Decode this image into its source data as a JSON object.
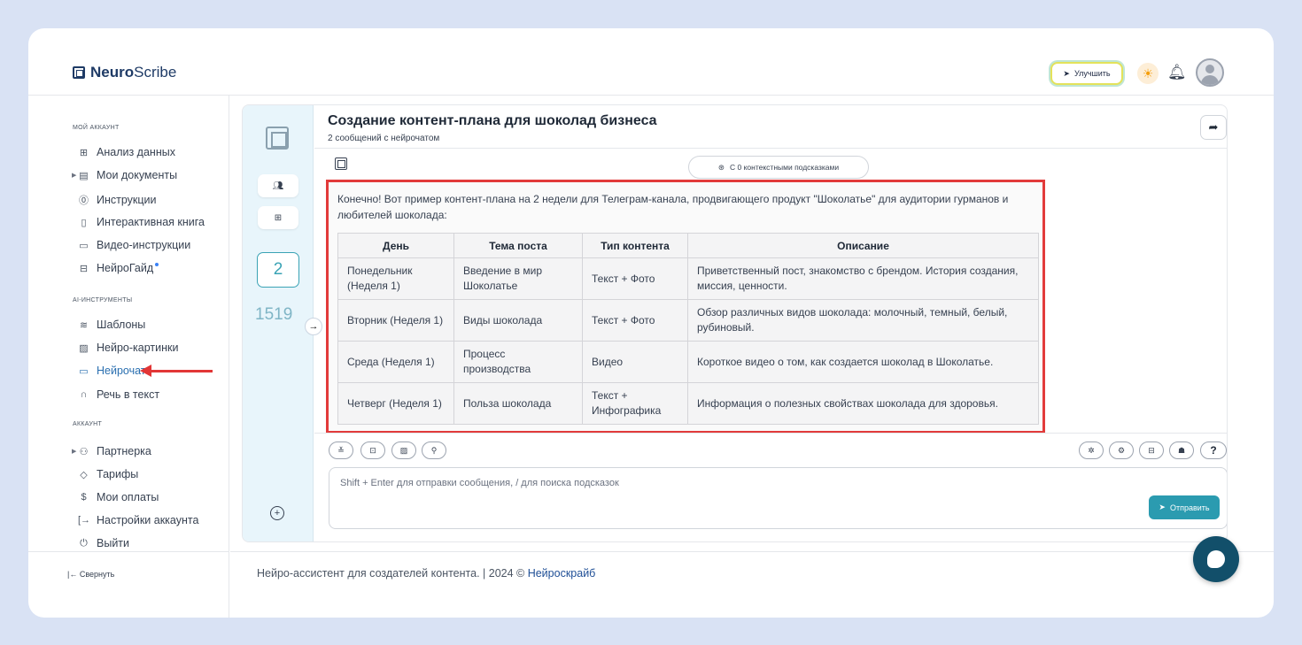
{
  "brand": {
    "bold": "Neuro",
    "light": "Scribe"
  },
  "topbar": {
    "upgrade_label": "Улучшить"
  },
  "sidebar": {
    "section_account": "МОЙ АККАУНТ",
    "account_items": [
      {
        "label": "Анализ данных",
        "icon": "grid-icon"
      },
      {
        "label": "Мои документы",
        "icon": "document-icon"
      },
      {
        "label": "Инструкции",
        "icon": "help-circle-icon"
      },
      {
        "label": "Интерактивная книга",
        "icon": "book-icon"
      },
      {
        "label": "Видео-инструкции",
        "icon": "video-icon"
      },
      {
        "label": "НейроГайд",
        "icon": "guide-icon"
      }
    ],
    "section_ai": "AI-ИНСТРУМЕНТЫ",
    "ai_items": [
      {
        "label": "Шаблоны",
        "icon": "layers-icon"
      },
      {
        "label": "Нейро-картинки",
        "icon": "image-icon"
      },
      {
        "label": "Нейрочат",
        "icon": "chat-icon"
      },
      {
        "label": "Речь в текст",
        "icon": "headphones-icon"
      }
    ],
    "section_settings": "АККАУНТ",
    "settings_items": [
      {
        "label": "Партнерка",
        "icon": "users-icon"
      },
      {
        "label": "Тарифы",
        "icon": "tag-icon"
      },
      {
        "label": "Мои оплаты",
        "icon": "dollar-icon"
      },
      {
        "label": "Настройки аккаунта",
        "icon": "login-icon"
      },
      {
        "label": "Выйти",
        "icon": "power-icon"
      }
    ],
    "collapse_label": "Свернуть"
  },
  "rail": {
    "count_primary": "2",
    "count_secondary": "1519"
  },
  "chat": {
    "title": "Создание контент-плана для шоколад бизнеса",
    "subtitle": "2 сообщений с нейрочатом",
    "context_hint": "С 0 контекстными подсказками",
    "message_intro": "Конечно! Вот пример контент-плана на 2 недели для Телеграм-канала, продвигающего продукт \"Шоколатье\" для аудитории гурманов и любителей шоколада:",
    "table": {
      "headers": [
        "День",
        "Тема поста",
        "Тип контента",
        "Описание"
      ],
      "rows": [
        [
          "Понедельник (Неделя 1)",
          "Введение в мир Шоколатье",
          "Текст + Фото",
          "Приветственный пост, знакомство с брендом. История создания, миссия, ценности."
        ],
        [
          "Вторник (Неделя 1)",
          "Виды шоколада",
          "Текст + Фото",
          "Обзор различных видов шоколада: молочный, темный, белый, рубиновый."
        ],
        [
          "Среда (Неделя 1)",
          "Процесс производства",
          "Видео",
          "Короткое видео о том, как создается шоколад в Шоколатье."
        ],
        [
          "Четверг (Неделя 1)",
          "Польза шоколада",
          "Текст + Инфографика",
          "Информация о полезных свойствах шоколада для здоровья."
        ]
      ]
    },
    "input_placeholder": "Shift + Enter для отправки сообщения, / для поиска подсказок",
    "send_label": "Отправить",
    "help_label": "?"
  },
  "footer": {
    "text": "Нейро-ассистент для создателей контента.  | 2024 © ",
    "link": "Нейроскрайб"
  },
  "colors": {
    "accent": "#2b9bb0",
    "brand": "#1f3b66",
    "highlight": "#e23b3b",
    "fab": "#124f6a"
  }
}
